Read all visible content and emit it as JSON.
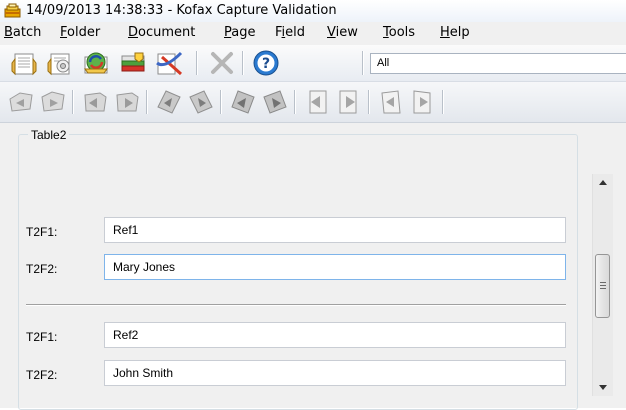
{
  "window": {
    "title": "14/09/2013 14:38:33 - Kofax Capture Validation"
  },
  "menu": {
    "items": [
      {
        "label": "Batch",
        "mnemonic": "B",
        "rest": "atch"
      },
      {
        "label": "Folder",
        "mnemonic": "F",
        "rest": "older"
      },
      {
        "label": "Document",
        "mnemonic": "D",
        "rest": "ocument"
      },
      {
        "label": "Page",
        "mnemonic": "P",
        "rest": "age"
      },
      {
        "label": "Field",
        "pre": "F",
        "mnemonic": "i",
        "rest": "eld"
      },
      {
        "label": "View",
        "mnemonic": "V",
        "rest": "iew"
      },
      {
        "label": "Tools",
        "mnemonic": "T",
        "rest": "ools"
      },
      {
        "label": "Help",
        "mnemonic": "H",
        "rest": "elp"
      }
    ]
  },
  "toolbar": {
    "filter_value": "All",
    "buttons": [
      "open-batch-icon",
      "close-batch-icon",
      "refresh-icon",
      "suspend-icon",
      "reject-icon",
      "delete-icon",
      "help-icon"
    ]
  },
  "navigation": {
    "buttons": [
      "first-batch-icon",
      "last-batch-icon",
      "prev-folder-icon",
      "next-folder-icon",
      "prev-document-icon",
      "next-document-icon",
      "prev-page-icon",
      "next-page-icon",
      "prev-field-icon",
      "next-field-icon",
      "prev-error-icon",
      "next-error-icon"
    ]
  },
  "form": {
    "table_title": "Table2",
    "rows": [
      {
        "f1_label": "T2F1:",
        "f1_value": "Ref1",
        "f2_label": "T2F2:",
        "f2_value": "Mary Jones"
      },
      {
        "f1_label": "T2F1:",
        "f1_value": "Ref2",
        "f2_label": "T2F2:",
        "f2_value": "John Smith"
      }
    ]
  }
}
